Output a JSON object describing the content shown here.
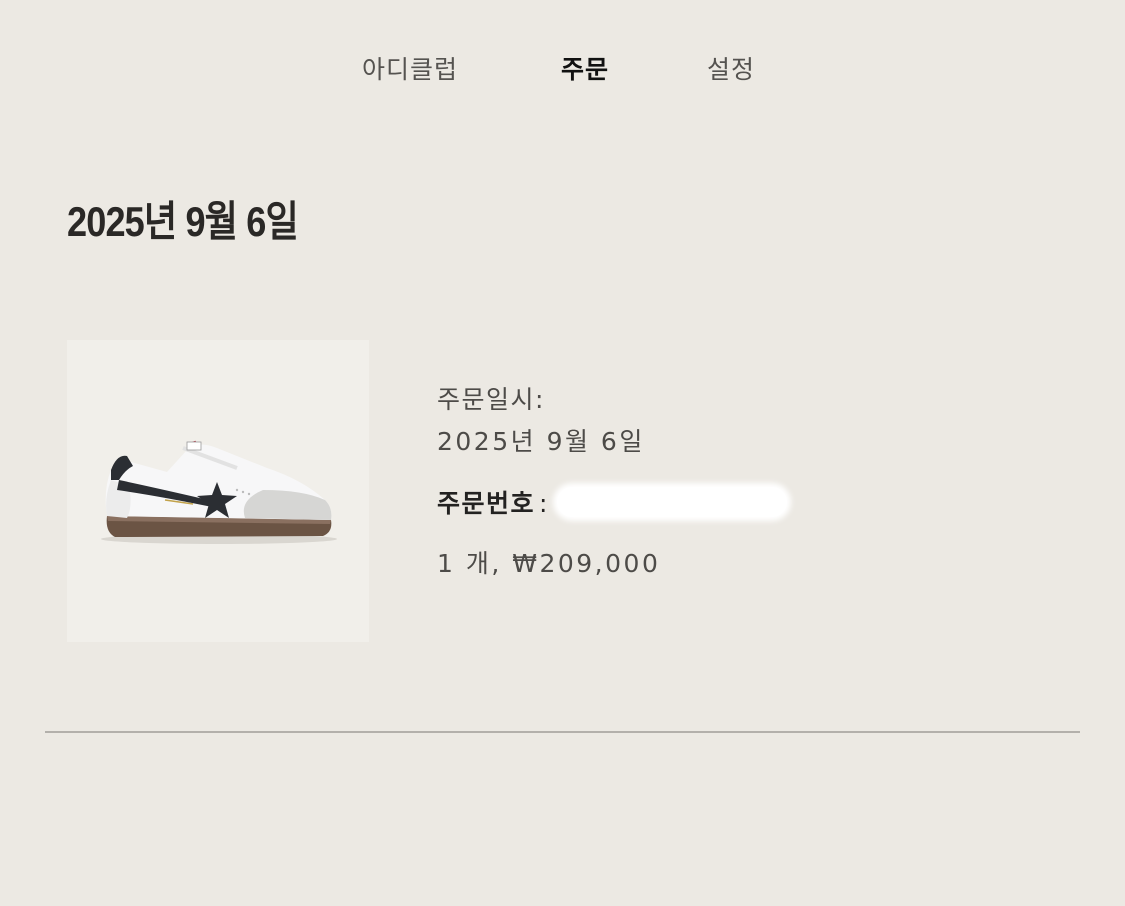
{
  "nav": {
    "tabs": [
      {
        "label": "아디클럽",
        "active": false
      },
      {
        "label": "주문",
        "active": true
      },
      {
        "label": "설정",
        "active": false
      }
    ]
  },
  "orders": [
    {
      "date_heading": "2025년 9월 6일",
      "product_image_icon": "sneaker-image",
      "order_date_label": "주문일시:",
      "order_date_value": "2025년 9월 6일",
      "order_number_label": "주문번호",
      "order_number_colon": ":",
      "quantity_price": "1 개, ₩209,000"
    }
  ],
  "colors": {
    "background": "#ece9e3",
    "image_background": "#f1efea",
    "divider": "#b3b0ab",
    "active_tab": "#111111",
    "inactive_tab": "#555350"
  }
}
